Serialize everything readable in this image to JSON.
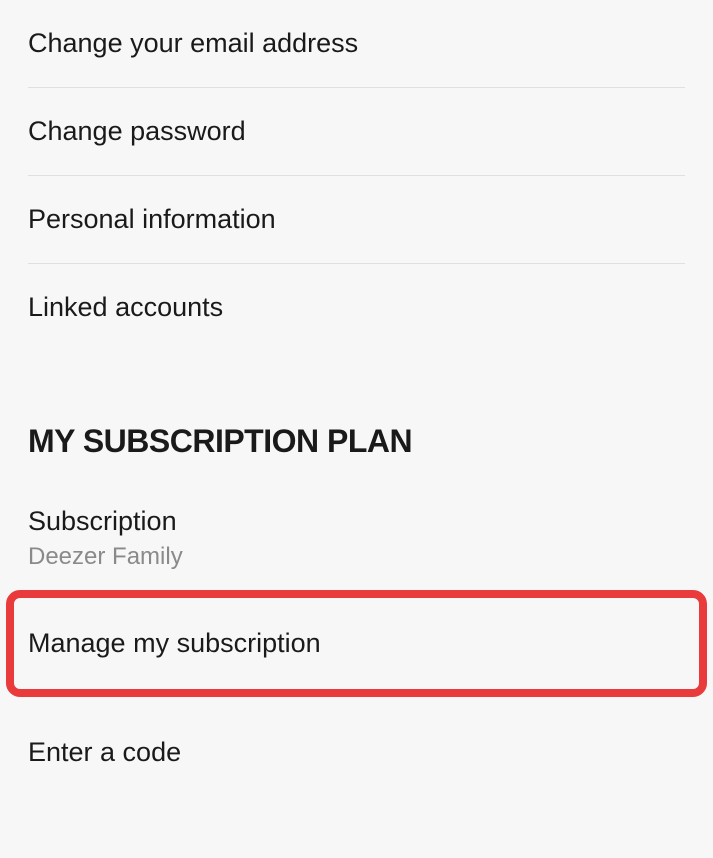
{
  "account_menu": {
    "change_email": "Change your email address",
    "change_password": "Change password",
    "personal_info": "Personal information",
    "linked_accounts": "Linked accounts"
  },
  "subscription_section": {
    "header": "MY SUBSCRIPTION PLAN",
    "subscription_label": "Subscription",
    "subscription_value": "Deezer Family",
    "manage": "Manage my subscription",
    "enter_code": "Enter a code"
  }
}
